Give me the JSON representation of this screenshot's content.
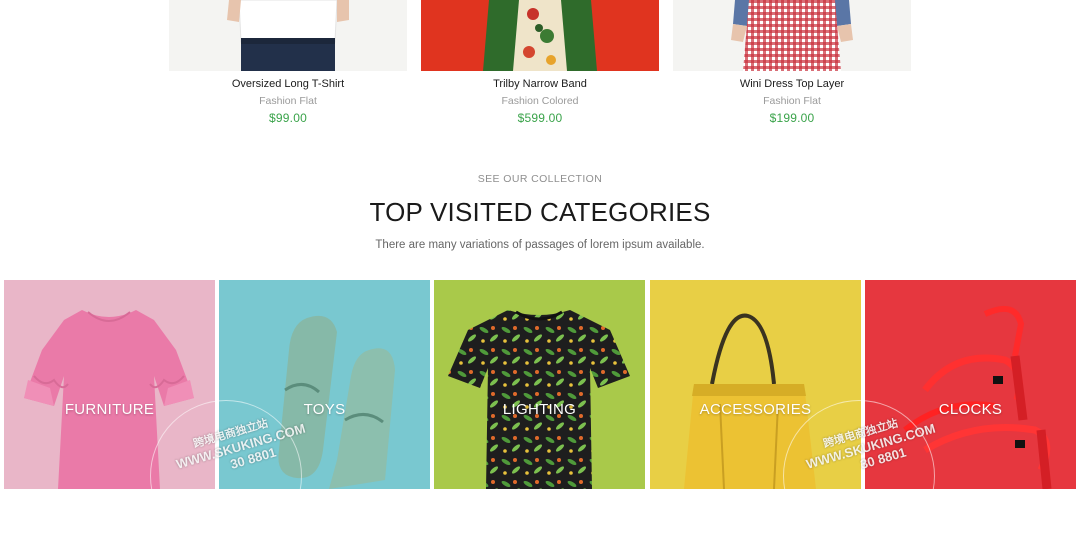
{
  "products": [
    {
      "name": "Oversized Long T-Shirt",
      "category": "Fashion Flat",
      "price": "$99.00"
    },
    {
      "name": "Trilby Narrow Band",
      "category": "Fashion Colored",
      "price": "$599.00"
    },
    {
      "name": "Wini Dress Top Layer",
      "category": "Fashion Flat",
      "price": "$199.00"
    }
  ],
  "section": {
    "eyebrow": "SEE OUR COLLECTION",
    "title": "TOP VISITED CATEGORIES",
    "subtitle": "There are many variations of passages of lorem ipsum available."
  },
  "categories": [
    {
      "label": "FURNITURE",
      "bg": "#e9b6c8"
    },
    {
      "label": "TOYS",
      "bg": "#79c8d0"
    },
    {
      "label": "LIGHTING",
      "bg": "#a9c94a"
    },
    {
      "label": "ACCESSORIES",
      "bg": "#e8cf45"
    },
    {
      "label": "CLOCKS",
      "bg": "#e6373f"
    }
  ],
  "watermark": {
    "line1": "跨境电商独立站",
    "line2": "WWW.SKUKING.COM",
    "line3": "30 8801"
  },
  "colors": {
    "price": "#3aa34a",
    "heading": "#1a1a1a"
  }
}
